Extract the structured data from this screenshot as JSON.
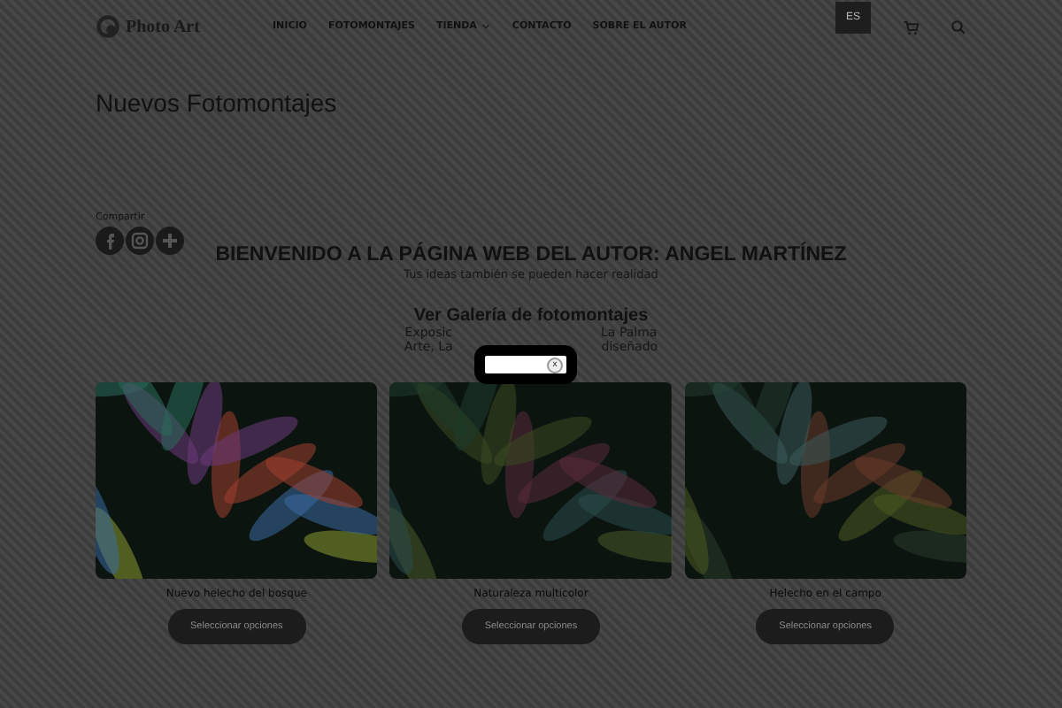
{
  "header": {
    "logo": "Photo Art",
    "nav": [
      {
        "label": "INICIO",
        "dropdown": false
      },
      {
        "label": "FOTOMONTAJES",
        "dropdown": false
      },
      {
        "label": "TIENDA",
        "dropdown": true
      },
      {
        "label": "CONTACTO",
        "dropdown": false
      },
      {
        "label": "SOBRE EL AUTOR",
        "dropdown": false
      }
    ],
    "language": "ES"
  },
  "page_title": "Nuevos Fotomontajes",
  "share": {
    "label": "Compartir"
  },
  "welcome": {
    "heading": "BIENVENIDO A LA PÁGINA WEB DEL AUTOR: ANGEL MARTÍNEZ",
    "subtitle": "Tus ideas también se pueden hacer realidad"
  },
  "gallery_intro": {
    "heading": "Ver Galería de fotomontajes",
    "lines": [
      {
        "left": "Exposic",
        "right": "La Palma"
      },
      {
        "left": "Arte, La",
        "right": "diseñado"
      }
    ]
  },
  "products": [
    {
      "caption": "Nuevo helecho del bosque",
      "button": "Seleccionar opciones"
    },
    {
      "caption": "Naturaleza multicolor",
      "button": "Seleccionar opciones"
    },
    {
      "caption": "Helecho en el campo",
      "button": "Seleccionar opciones"
    }
  ],
  "popup": {
    "close": "x"
  }
}
